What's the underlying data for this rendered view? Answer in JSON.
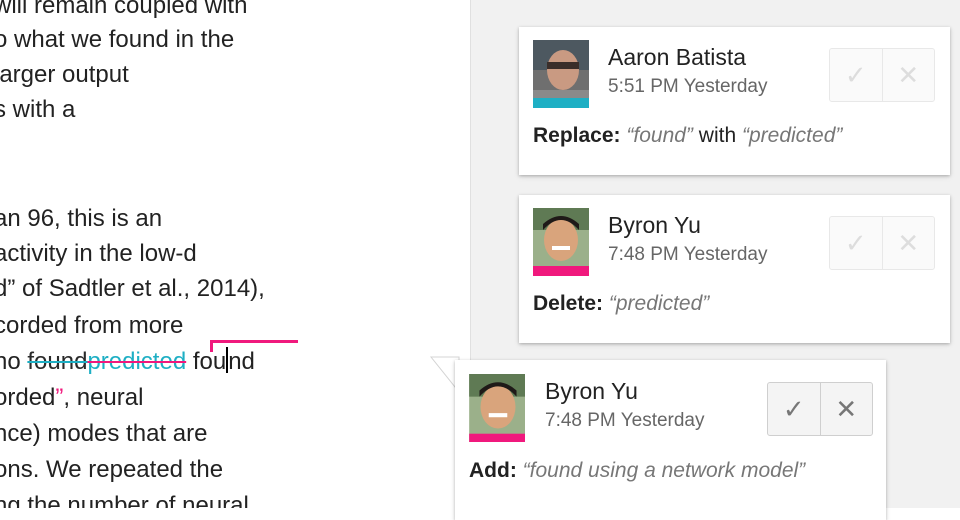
{
  "document": {
    "lines": [
      "will remain coupled with",
      "o what we found in the",
      "larger output",
      "s with a",
      "",
      "an 96, this is an",
      "activity in the low-d",
      "d” of Sadtler et al., 2014),",
      "corded from more"
    ],
    "edit_line": {
      "prefix": "ho ",
      "deleted_text": "found",
      "suggested_deleted_text": "predicted",
      "after_start": " fou",
      "after_end": "nd"
    },
    "line_orded": {
      "text": "orded",
      "quote": "”",
      "rest": ", neural"
    },
    "lines_after": [
      "nce) modes that are",
      "ons. We repeated the",
      "ng the number of neural"
    ]
  },
  "comments": [
    {
      "author": "Aaron Batista",
      "time": "5:51 PM Yesterday",
      "action": "Replace:",
      "from": "“found”",
      "connector": "with",
      "to": "“predicted”",
      "accent": "#1eafc4",
      "accept_icon": "checkmark-icon",
      "reject_icon": "close-icon"
    },
    {
      "author": "Byron Yu",
      "time": "7:48 PM Yesterday",
      "action": "Delete:",
      "text": "“predicted”",
      "accent": "#f0197d",
      "accept_icon": "checkmark-icon",
      "reject_icon": "close-icon"
    },
    {
      "author": "Byron Yu",
      "time": "7:48 PM Yesterday",
      "action": "Add:",
      "text": "“found using a network model”",
      "accent": "#f0197d",
      "accept_icon": "checkmark-icon",
      "reject_icon": "close-icon"
    }
  ],
  "colors": {
    "teal": "#1eafc4",
    "pink": "#f0197d"
  }
}
